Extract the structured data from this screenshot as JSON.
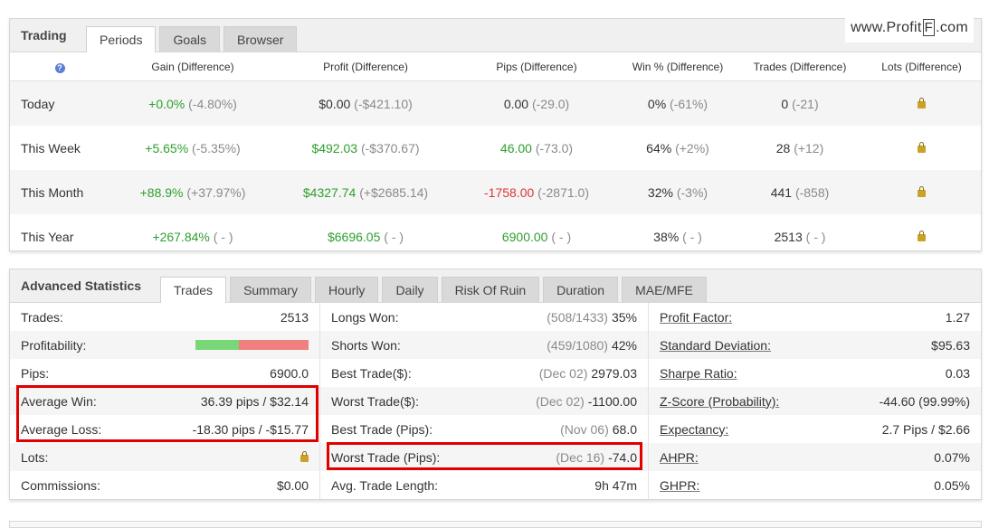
{
  "trading": {
    "title": "Trading",
    "tabs": [
      "Periods",
      "Goals",
      "Browser"
    ],
    "active_tab": 0,
    "watermark_pre": "www.Profit",
    "watermark_mid": "F",
    "watermark_post": ".com",
    "headers": [
      "Gain (Difference)",
      "Profit (Difference)",
      "Pips (Difference)",
      "Win % (Difference)",
      "Trades (Difference)",
      "Lots (Difference)"
    ],
    "help_glyph": "?",
    "rows": [
      {
        "label": "Today",
        "gain": "+0.0%",
        "gain_diff": "(-4.80%)",
        "profit": "$0.00",
        "profit_diff": "(-$421.10)",
        "pips": "0.00",
        "pips_diff": "(-29.0)",
        "win": "0%",
        "win_diff": "(-61%)",
        "trades": "0",
        "trades_diff": "(-21)"
      },
      {
        "label": "This Week",
        "gain": "+5.65%",
        "gain_diff": "(-5.35%)",
        "profit": "$492.03",
        "profit_diff": "(-$370.67)",
        "pips": "46.00",
        "pips_diff": "(-73.0)",
        "win": "64%",
        "win_diff": "(+2%)",
        "trades": "28",
        "trades_diff": "(+12)"
      },
      {
        "label": "This Month",
        "gain": "+88.9%",
        "gain_diff": "(+37.97%)",
        "profit": "$4327.74",
        "profit_diff": "(+$2685.14)",
        "pips": "-1758.00",
        "pips_diff": "(-2871.0)",
        "win": "32%",
        "win_diff": "(-3%)",
        "trades": "441",
        "trades_diff": "(-858)"
      },
      {
        "label": "This Year",
        "gain": "+267.84%",
        "gain_diff": "( - )",
        "profit": "$6696.05",
        "profit_diff": "( - )",
        "pips": "6900.00",
        "pips_diff": "( - )",
        "win": "38%",
        "win_diff": "( - )",
        "trades": "2513",
        "trades_diff": "( - )"
      }
    ]
  },
  "advanced": {
    "title": "Advanced Statistics",
    "tabs": [
      "Trades",
      "Summary",
      "Hourly",
      "Daily",
      "Risk Of Ruin",
      "Duration",
      "MAE/MFE"
    ],
    "active_tab": 0,
    "col1": [
      {
        "label": "Trades:",
        "value": "2513"
      },
      {
        "label": "Profitability:",
        "value": ""
      },
      {
        "label": "Pips:",
        "value": "6900.0"
      },
      {
        "label": "Average Win:",
        "value": "36.39 pips / $32.14"
      },
      {
        "label": "Average Loss:",
        "value": "-18.30 pips / -$15.77"
      },
      {
        "label": "Lots:",
        "value": ""
      },
      {
        "label": "Commissions:",
        "value": "$0.00"
      }
    ],
    "profitability_win_fraction": 0.38,
    "col2": [
      {
        "label": "Longs Won:",
        "muted": "(508/1433)",
        "value": "35%"
      },
      {
        "label": "Shorts Won:",
        "muted": "(459/1080)",
        "value": "42%"
      },
      {
        "label": "Best Trade($):",
        "muted": "(Dec 02)",
        "value": "2979.03"
      },
      {
        "label": "Worst Trade($):",
        "muted": "(Dec 02)",
        "value": "-1100.00"
      },
      {
        "label": "Best Trade (Pips):",
        "muted": "(Nov 06)",
        "value": "68.0"
      },
      {
        "label": "Worst Trade (Pips):",
        "muted": "(Dec 16)",
        "value": "-74.0"
      },
      {
        "label": "Avg. Trade Length:",
        "muted": "",
        "value": "9h 47m"
      }
    ],
    "col3": [
      {
        "label": "Profit Factor:",
        "value": "1.27"
      },
      {
        "label": "Standard Deviation:",
        "value": "$95.63"
      },
      {
        "label": "Sharpe Ratio:",
        "value": "0.03"
      },
      {
        "label": "Z-Score (Probability):",
        "value": "-44.60 (99.99%)"
      },
      {
        "label": "Expectancy:",
        "value": "2.7 Pips / $2.66"
      },
      {
        "label": "AHPR:",
        "value": "0.07%"
      },
      {
        "label": "GHPR:",
        "value": "0.05%"
      }
    ]
  },
  "colors": {
    "positive": "#2e9f2e",
    "negative": "#d93636",
    "highlight_box": "#e00000"
  }
}
